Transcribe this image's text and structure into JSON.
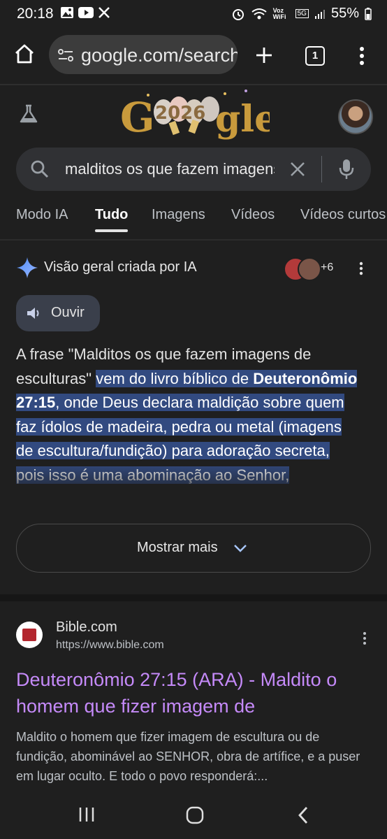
{
  "status_bar": {
    "time": "20:18",
    "battery": "55%",
    "voz_wifi": "Voz WiFi",
    "network": "5G"
  },
  "browser": {
    "url": "google.com/search",
    "tab_count": "1"
  },
  "search": {
    "query": "malditos os que fazem imagens de esculturas"
  },
  "tabs": [
    {
      "label": "Modo IA",
      "active": false
    },
    {
      "label": "Tudo",
      "active": true
    },
    {
      "label": "Imagens",
      "active": false
    },
    {
      "label": "Vídeos",
      "active": false
    },
    {
      "label": "Vídeos curtos",
      "active": false
    }
  ],
  "ai_overview": {
    "title": "Visão geral criada por IA",
    "sources_more": "+6",
    "listen_label": "Ouvir",
    "text_plain": "A frase \"Malditos os que fazem imagens de esculturas\" ",
    "text_hl_1": "vem do livro bíblico de ",
    "text_hl_bold": "Deuteronômio 27:15",
    "text_hl_2": ", onde Deus declara maldição sobre quem faz ídolos de madeira, pedra ou metal (imagens de escultura/fundição) para adoração secreta, pois isso é uma abominação ao Senhor,",
    "show_more_label": "Mostrar mais"
  },
  "result": {
    "site_name": "Bible.com",
    "site_url": "https://www.bible.com",
    "title": "Deuteronômio 27:15 (ARA) - Maldito o homem que fizer imagem de",
    "snippet": "Maldito o homem que fizer imagem de escultura ou de fundição, abominável ao SENHOR, obra de artífice, e a puser em lugar oculto. E todo o povo responderá:..."
  },
  "colors": {
    "background": "#1f1f1f",
    "highlight": "#324a80",
    "link_title": "#c58af9",
    "search_bar": "#303134"
  }
}
